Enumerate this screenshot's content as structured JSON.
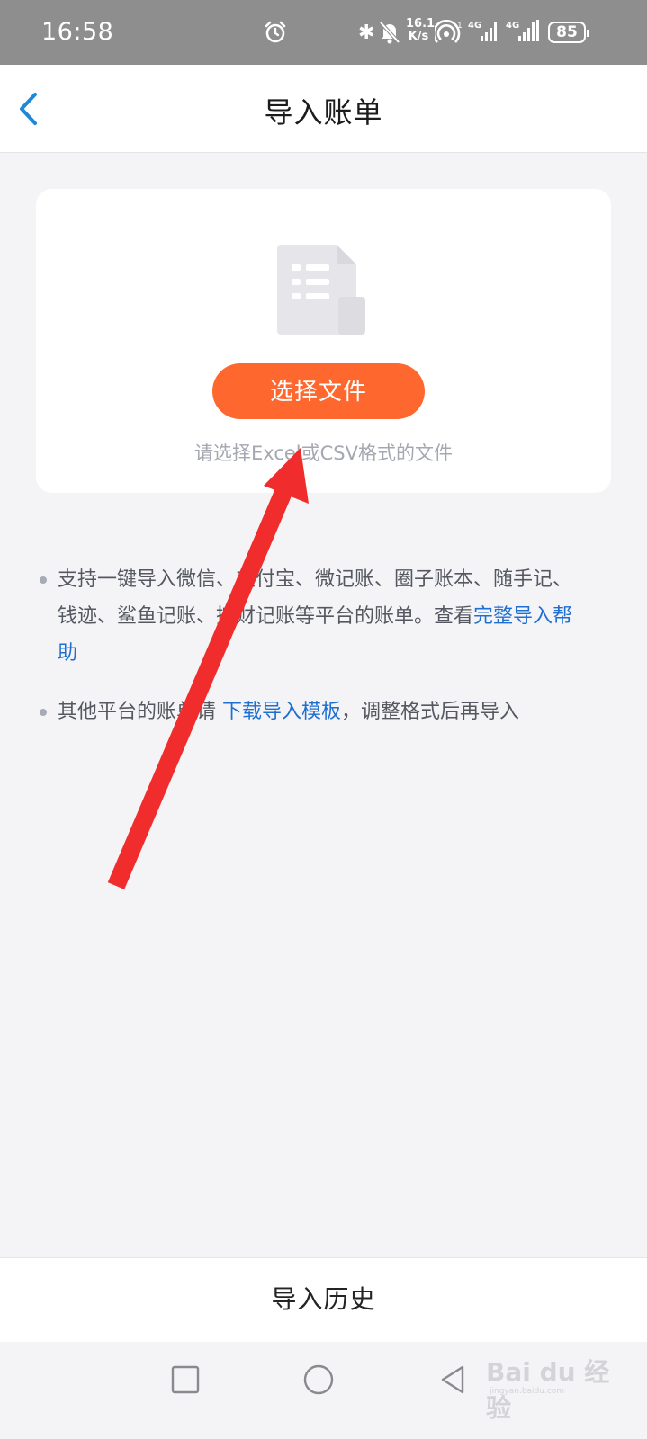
{
  "status_bar": {
    "time": "16:58",
    "net_speed_value": "16.1",
    "net_speed_unit": "K/s",
    "battery": "85",
    "icons": [
      "alarm-icon",
      "bluetooth-icon",
      "mute-icon",
      "hotspot-icon",
      "signal-4g-icon",
      "signal-4g-icon",
      "battery-icon"
    ]
  },
  "header": {
    "title": "导入账单",
    "back_icon": "chevron-left-icon"
  },
  "upload_card": {
    "icon": "document-icon",
    "button_label": "选择文件",
    "hint": "请选择Excel或CSV格式的文件"
  },
  "tips": [
    {
      "text": "支持一键导入微信、支付宝、微记账、圈子账本、随手记、钱迹、鲨鱼记账、挖财记账等平台的账单。查看",
      "link": "完整导入帮助",
      "suffix": ""
    },
    {
      "text": "其他平台的账单请 ",
      "link": "下载导入模板",
      "suffix": "，调整格式后再导入"
    }
  ],
  "bottom": {
    "history_label": "导入历史"
  },
  "nav": {
    "icons": [
      "square-recent-icon",
      "circle-home-icon",
      "triangle-back-icon"
    ]
  },
  "watermark": {
    "main": "Bai du 经验",
    "sub": "jingyan.baidu.com"
  },
  "colors": {
    "accent": "#fe672d",
    "link": "#1f6fd1",
    "back_arrow": "#1e88d8",
    "annotation_arrow": "#f02c2c"
  }
}
